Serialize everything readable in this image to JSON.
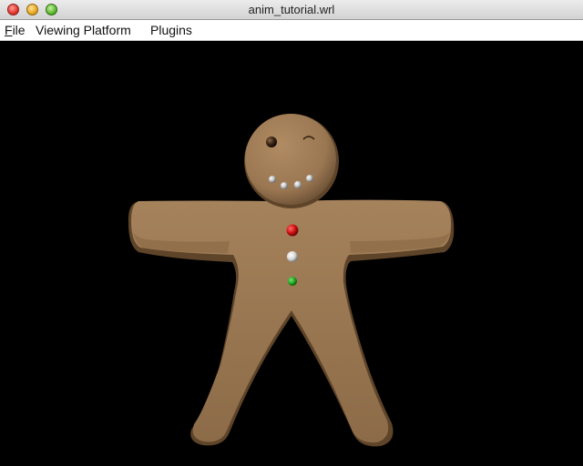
{
  "window": {
    "title": "anim_tutorial.wrl",
    "controls": [
      "close",
      "minimize",
      "zoom"
    ]
  },
  "menubar": {
    "file_mnemonic": "F",
    "file_rest": "ile",
    "viewing_platform": "Viewing Platform",
    "plugins": "Plugins"
  },
  "scene": {
    "background": "#000000",
    "figure": "gingerbread-man",
    "body_color": "#9c7a55",
    "button_colors": [
      "#cc1111",
      "#d8d8d8",
      "#22aa22"
    ]
  }
}
